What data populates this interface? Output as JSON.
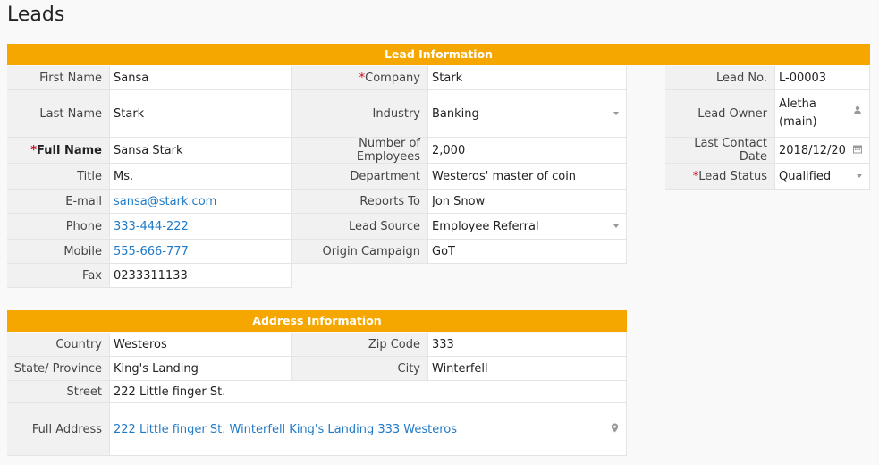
{
  "page": {
    "title": "Leads"
  },
  "lead_section": {
    "header": "Lead Information",
    "col1": [
      {
        "label": "First Name",
        "value": "Sansa"
      },
      {
        "label": "Last Name",
        "value": "Stark"
      },
      {
        "label": "Full Name",
        "value": "Sansa Stark",
        "required_mark": "*"
      },
      {
        "label": "Title",
        "value": "Ms."
      },
      {
        "label": "E-mail",
        "value": "sansa@stark.com"
      },
      {
        "label": "Phone",
        "value": "333-444-222"
      },
      {
        "label": "Mobile",
        "value": "555-666-777"
      },
      {
        "label": "Fax",
        "value": "0233311133"
      }
    ],
    "col2": [
      {
        "label": "Company",
        "value": "Stark",
        "required_mark": "*"
      },
      {
        "label": "Industry",
        "value": "Banking"
      },
      {
        "label": "Number of Employees",
        "value": "2,000"
      },
      {
        "label": "Department",
        "value": "Westeros' master of coin"
      },
      {
        "label": "Reports To",
        "value": "Jon Snow"
      },
      {
        "label": "Lead Source",
        "value": "Employee Referral"
      },
      {
        "label": "Origin Campaign",
        "value": "GoT"
      }
    ],
    "col3": [
      {
        "label": "Lead No.",
        "value": "L-00003"
      },
      {
        "label": "Lead Owner",
        "value_line1": "Aletha",
        "value_line2": "(main)"
      },
      {
        "label": "Last Contact Date",
        "value": "2018/12/20"
      },
      {
        "label": "Lead Status",
        "value": "Qualified",
        "required_mark": "*"
      }
    ]
  },
  "address_section": {
    "header": "Address Information",
    "rows": [
      {
        "label": "Country",
        "value": "Westeros"
      },
      {
        "label": "Zip Code",
        "value": "333"
      },
      {
        "label": "State/ Province",
        "value": "King's Landing"
      },
      {
        "label": "City",
        "value": "Winterfell"
      },
      {
        "label": "Street",
        "value": "222 Little finger St."
      },
      {
        "label": "Full Address",
        "value": "222 Little finger St. Winterfell King's Landing 333 Westeros"
      }
    ]
  },
  "icons": {
    "dropdown": "chevron-down-icon",
    "person": "user-icon",
    "calendar": "calendar-icon",
    "map-pin": "map-pin-icon"
  },
  "colors": {
    "section_header": "#f5a700",
    "link": "#1f7ac7",
    "required": "#d0021b"
  }
}
